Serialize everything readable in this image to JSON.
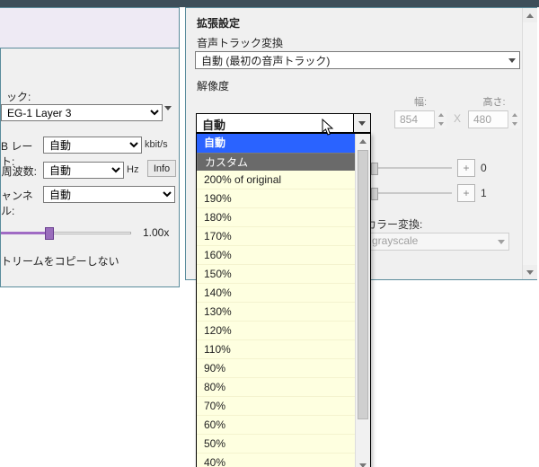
{
  "colors": {
    "accent": "#9a6dbc",
    "panel": "#f0f0f0",
    "dropdown_bg": "#feffe0"
  },
  "left_panel": {
    "codec_lbl": "ック:",
    "codec_value": "EG-1 Layer 3",
    "bitrate_lbl": "B レート:",
    "bitrate_value": "自動",
    "bitrate_unit": "kbit/s",
    "freq_lbl": "周波数:",
    "freq_value": "自動",
    "freq_unit": "Hz",
    "info_btn": "Info",
    "channel_lbl": "ャンネル:",
    "channel_value": "自動",
    "tempo_value": "1.00x",
    "copy_lbl": "トリームをコピーしない"
  },
  "right_panel": {
    "section_title": "拡張設定",
    "audio_track_lbl": "音声トラック変換",
    "audio_track_value": "自動 (最初の音声トラック)",
    "resolution_lbl": "解像度",
    "width_lbl": "幅:",
    "width_value": "854",
    "mul": "X",
    "height_lbl": "高さ:",
    "height_value": "480",
    "slider_a_value": "0",
    "slider_b_value": "1",
    "color_lbl": "カラー変換:",
    "color_value": "grayscale"
  },
  "resolution_combo": {
    "selected": "自動",
    "options": [
      "自動",
      "カスタム",
      "200% of original",
      "190%",
      "180%",
      "170%",
      "160%",
      "150%",
      "140%",
      "130%",
      "120%",
      "110%",
      "90%",
      "80%",
      "70%",
      "60%",
      "50%",
      "40%"
    ]
  }
}
